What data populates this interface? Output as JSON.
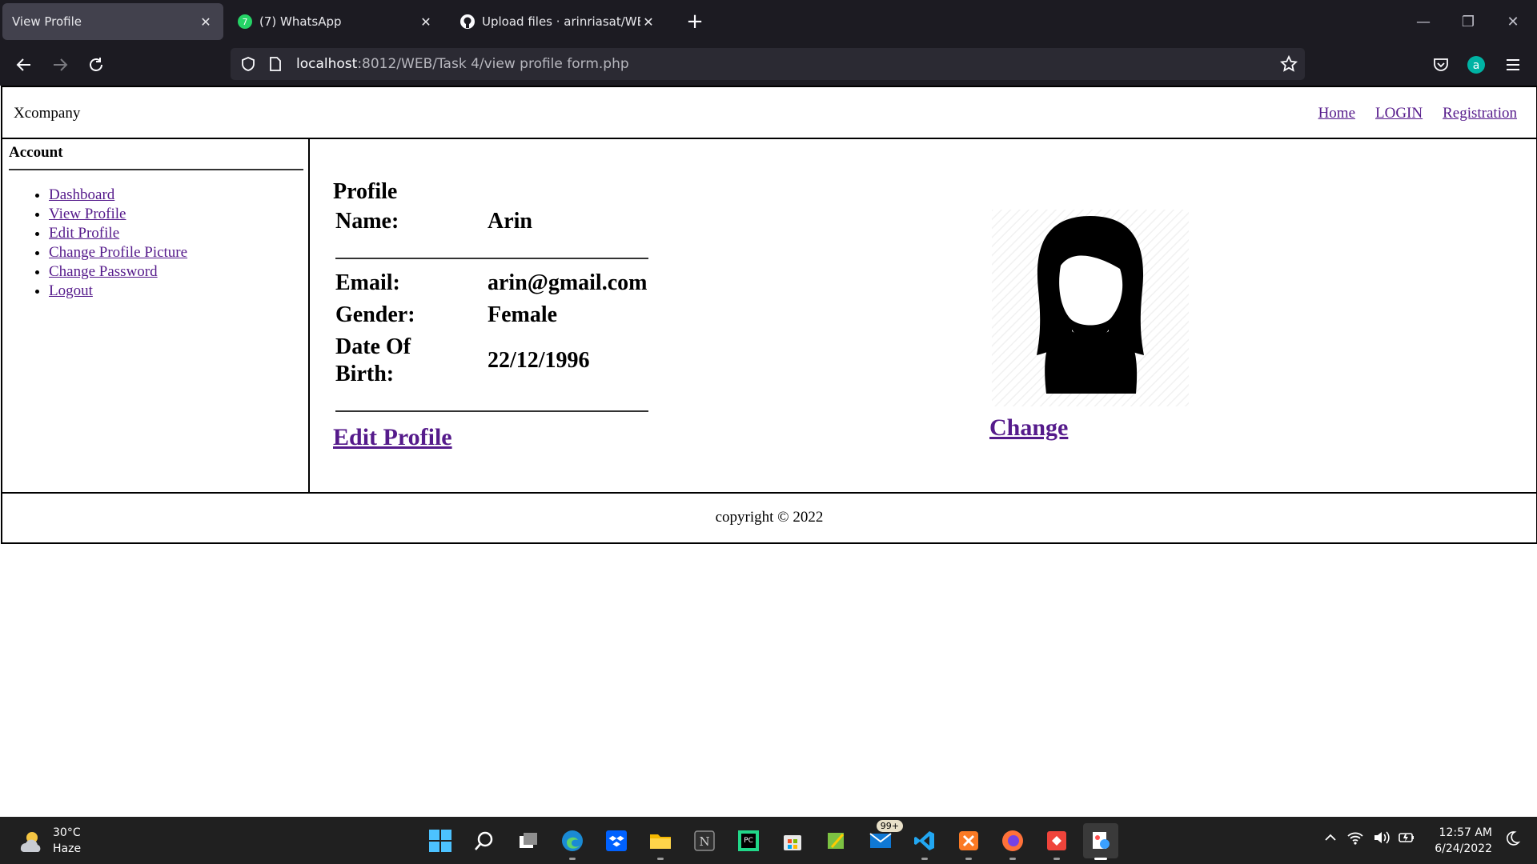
{
  "browser": {
    "tabs": [
      {
        "label": "View Profile",
        "active": true,
        "icon": "none"
      },
      {
        "label": "(7) WhatsApp",
        "active": false,
        "icon": "whatsapp-icon"
      },
      {
        "label": "Upload files · arinriasat/WEB-TE",
        "active": false,
        "icon": "github-icon"
      }
    ],
    "url_host": "localhost",
    "url_rest": ":8012/WEB/Task 4/view profile form.php"
  },
  "site": {
    "brand": "Xcompany",
    "nav": [
      "Home",
      "LOGIN",
      "Registration"
    ],
    "sidebar": {
      "title": "Account",
      "items": [
        "Dashboard",
        "View Profile",
        "Edit Profile",
        "Change Profile Picture",
        "Change Password",
        "Logout"
      ]
    },
    "profile": {
      "title": "Profile",
      "fields": [
        {
          "label": "Name:",
          "value": "Arin"
        },
        {
          "label": "Email:",
          "value": "arin@gmail.com"
        },
        {
          "label": "Gender:",
          "value": "Female"
        },
        {
          "label": "Date Of Birth:",
          "value": "22/12/1996"
        }
      ],
      "edit_link": "Edit Profile",
      "change_link": "Change"
    },
    "footer": "copyright © 2022"
  },
  "taskbar": {
    "weather_temp": "30°C",
    "weather_desc": "Haze",
    "mail_badge": "99+",
    "time": "12:57 AM",
    "date": "6/24/2022"
  }
}
